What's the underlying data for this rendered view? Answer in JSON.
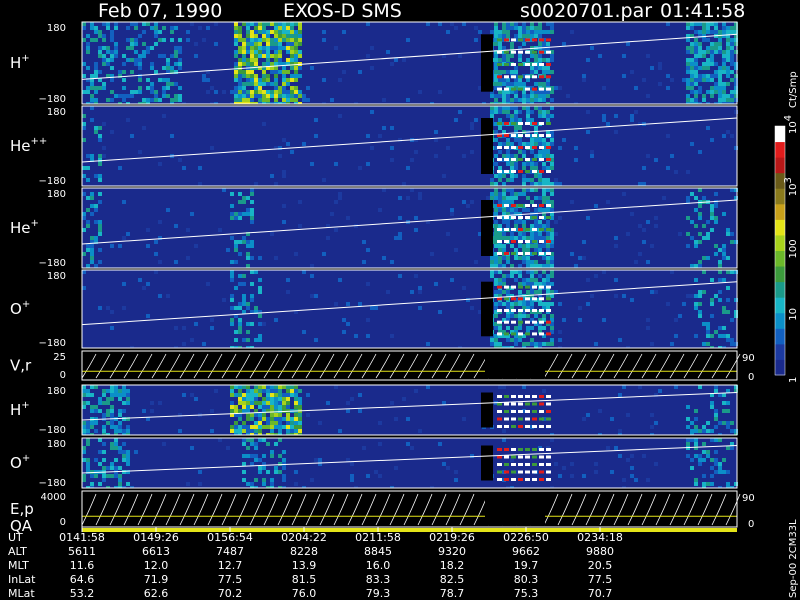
{
  "header": {
    "date": "Feb 07, 1990",
    "mission": "EXOS-D SMS",
    "file": "s0020701.par",
    "time": "01:41:58"
  },
  "chart_data": {
    "type": "heatmap",
    "panels": [
      {
        "id": "hplus1",
        "label": "H",
        "sup": "+",
        "ymax": "180",
        "ymin": "−180",
        "kind": "spec"
      },
      {
        "id": "hepp",
        "label": "He",
        "sup": "++",
        "ymax": "180",
        "ymin": "−180",
        "kind": "spec"
      },
      {
        "id": "heplus",
        "label": "He",
        "sup": "+",
        "ymax": "180",
        "ymin": "−180",
        "kind": "spec"
      },
      {
        "id": "oplus1",
        "label": "O",
        "sup": "+",
        "ymax": "180",
        "ymin": "−180",
        "kind": "spec"
      },
      {
        "id": "vr",
        "label": "V,r",
        "sup": "",
        "ymax": "25",
        "ymin": "0",
        "rmax": "90",
        "rmin": "0",
        "kind": "line"
      },
      {
        "id": "hplus2",
        "label": "H",
        "sup": "+",
        "ymax": "180",
        "ymin": "−180",
        "kind": "spec"
      },
      {
        "id": "oplus2",
        "label": "O",
        "sup": "+",
        "ymax": "180",
        "ymin": "−180",
        "kind": "spec"
      },
      {
        "id": "ep",
        "label": "E,p",
        "label2": "QA",
        "sup": "",
        "ymax": "4000",
        "ymin": "0",
        "rmax": "90",
        "rmin": "0",
        "kind": "line"
      }
    ],
    "colorbar": {
      "title": "Ct/Smp",
      "ticks": [
        {
          "t": "10",
          "sup": "4",
          "v": 4
        },
        {
          "t": "10",
          "sup": "3",
          "v": 3
        },
        {
          "t": "100",
          "sup": "",
          "v": 2
        },
        {
          "t": "10",
          "sup": "",
          "v": 1
        },
        {
          "t": "1",
          "sup": "",
          "v": 0
        }
      ],
      "colors": [
        "#1a2a8c",
        "#1c3aa0",
        "#1260c0",
        "#0b8fc8",
        "#18b5c6",
        "#1a9a8a",
        "#3c9a3c",
        "#6cb82a",
        "#a8d21c",
        "#e4e418",
        "#c8a01a",
        "#8a7a1c",
        "#6a5a18",
        "#b81818",
        "#e01c1c",
        "#ffffff"
      ]
    },
    "x_axis": {
      "ut": [
        "0141:58",
        "0149:26",
        "0156:54",
        "0204:22",
        "0211:58",
        "0219:26",
        "0226:50",
        "0234:18"
      ],
      "rows": [
        {
          "name": "UT",
          "values": [
            "0141:58",
            "0149:26",
            "0156:54",
            "0204:22",
            "0211:58",
            "0219:26",
            "0226:50",
            "0234:18"
          ]
        },
        {
          "name": "ALT",
          "values": [
            "5611",
            "6613",
            "7487",
            "8228",
            "8845",
            "9320",
            "9662",
            "9880"
          ]
        },
        {
          "name": "MLT",
          "values": [
            "11.6",
            "12.0",
            "12.7",
            "13.9",
            "16.0",
            "18.2",
            "19.7",
            "20.5"
          ]
        },
        {
          "name": "InLat",
          "values": [
            "64.6",
            "71.9",
            "77.5",
            "81.5",
            "83.3",
            "82.5",
            "80.3",
            "77.5"
          ]
        },
        {
          "name": "MLat",
          "values": [
            "53.2",
            "62.6",
            "70.2",
            "76.0",
            "79.3",
            "78.7",
            "75.3",
            "70.7"
          ]
        }
      ]
    },
    "side_note": "Sep-00 2CM33L"
  }
}
